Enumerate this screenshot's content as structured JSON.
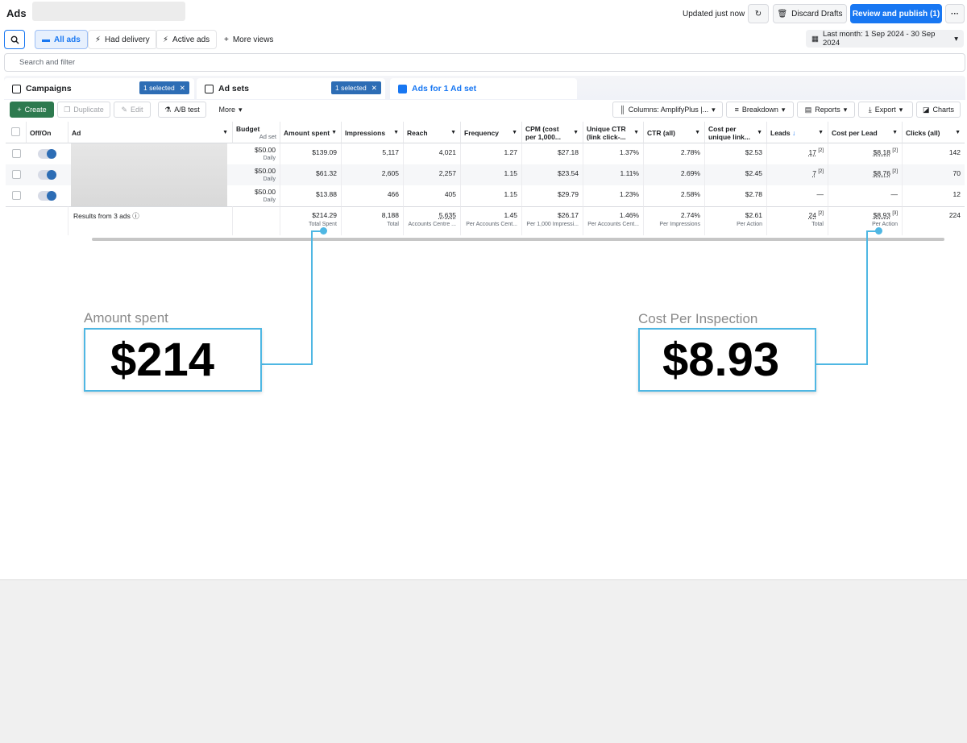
{
  "app": {
    "title": "Ads"
  },
  "topbar": {
    "updated": "Updated just now",
    "discard": "Discard Drafts",
    "publish": "Review and publish (1)",
    "more": "···"
  },
  "views": {
    "all": "All ads",
    "delivery": "Had delivery",
    "active": "Active ads",
    "more": "More views"
  },
  "date_range": "Last month: 1 Sep 2024 - 30 Sep 2024",
  "filter": {
    "placeholder": "Search and filter"
  },
  "tabs": {
    "campaigns": "Campaigns",
    "adsets": "Ad sets",
    "ads": "Ads for 1 Ad set",
    "selected": "1 selected"
  },
  "toolbar": {
    "create": "Create",
    "duplicate": "Duplicate",
    "edit": "Edit",
    "ab_test": "A/B test",
    "more": "More",
    "columns": "Columns: AmplifyPlus |...",
    "breakdown": "Breakdown",
    "reports": "Reports",
    "export": "Export",
    "charts": "Charts"
  },
  "table": {
    "headers": {
      "offon": "Off/On",
      "ad": "Ad",
      "budget": "Budget",
      "budget_sub": "Ad set",
      "amount": "Amount spent",
      "impressions": "Impressions",
      "reach": "Reach",
      "frequency": "Frequency",
      "cpm": "CPM (cost per 1,000...",
      "uctr": "Unique CTR (link click-...",
      "ctr": "CTR (all)",
      "cpu": "Cost per unique link...",
      "leads": "Leads",
      "cpl": "Cost per Lead",
      "clicks": "Clicks (all)"
    },
    "rows": [
      {
        "budget": "$50.00",
        "budget_sub": "Daily",
        "amount": "$139.09",
        "impressions": "5,117",
        "reach": "4,021",
        "frequency": "1.27",
        "cpm": "$27.18",
        "uctr": "1.37%",
        "ctr": "2.78%",
        "cpu": "$2.53",
        "leads": "17",
        "cpl": "$8.18",
        "clicks": "142"
      },
      {
        "budget": "$50.00",
        "budget_sub": "Daily",
        "amount": "$61.32",
        "impressions": "2,605",
        "reach": "2,257",
        "frequency": "1.15",
        "cpm": "$23.54",
        "uctr": "1.11%",
        "ctr": "2.69%",
        "cpu": "$2.45",
        "leads": "7",
        "cpl": "$8.76",
        "clicks": "70"
      },
      {
        "budget": "$50.00",
        "budget_sub": "Daily",
        "amount": "$13.88",
        "impressions": "466",
        "reach": "405",
        "frequency": "1.15",
        "cpm": "$29.79",
        "uctr": "1.23%",
        "ctr": "2.58%",
        "cpu": "$2.78",
        "leads": "—",
        "cpl": "—",
        "clicks": "12"
      }
    ],
    "footnote": "[2]",
    "totals": {
      "label": "Results from 3 ads",
      "amount": "$214.29",
      "amount_sub": "Total Spent",
      "impressions": "8,188",
      "impressions_sub": "Total",
      "reach": "5,635",
      "reach_sub": "Accounts Centre ...",
      "frequency": "1.45",
      "frequency_sub": "Per Accounts Cent...",
      "cpm": "$26.17",
      "cpm_sub": "Per 1,000 Impressi...",
      "uctr": "1.46%",
      "uctr_sub": "Per Accounts Cent...",
      "ctr": "2.74%",
      "ctr_sub": "Per Impressions",
      "cpu": "$2.61",
      "cpu_sub": "Per Action",
      "leads": "24",
      "leads_sub": "Total",
      "cpl": "$8.93",
      "cpl_sub": "Per Action",
      "clicks": "224",
      "footnote": "[3]"
    }
  },
  "callouts": {
    "amount": {
      "label": "Amount spent",
      "value": "$214"
    },
    "cpi": {
      "label": "Cost Per Inspection",
      "value": "$8.93"
    }
  }
}
